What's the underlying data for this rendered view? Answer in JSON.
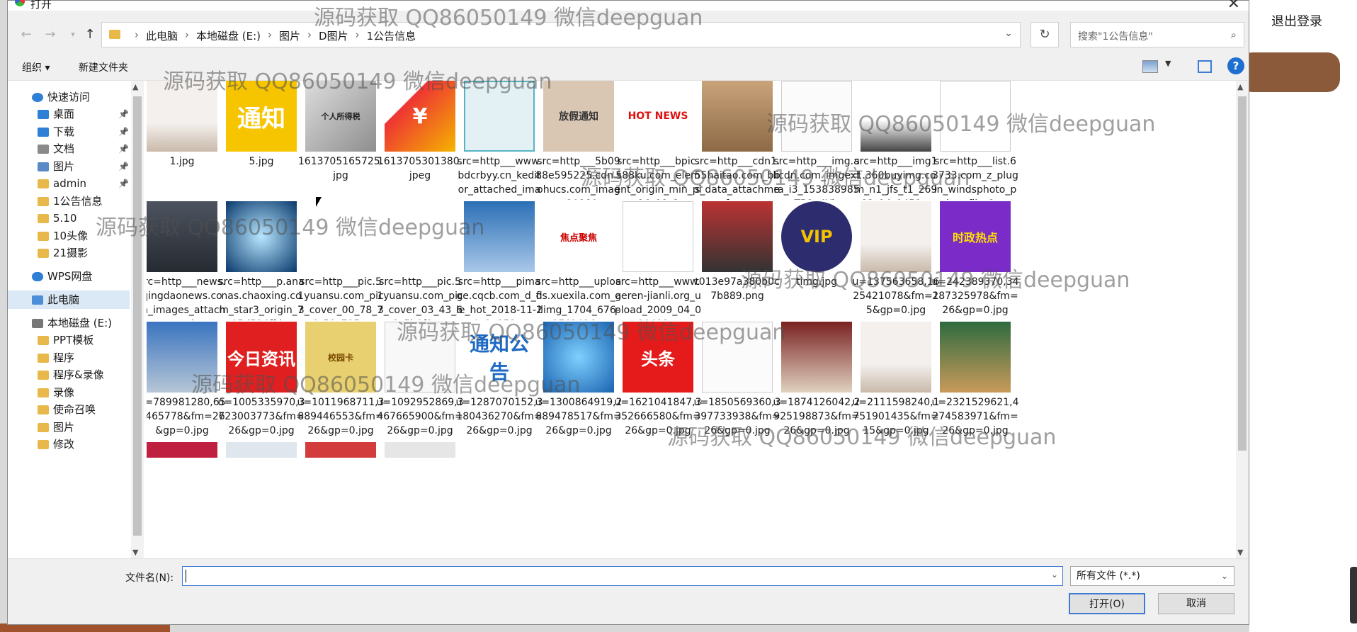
{
  "background_app": {
    "logout_label": "退出登录"
  },
  "dialog": {
    "title": "打开",
    "address": {
      "crumbs": [
        "此电脑",
        "本地磁盘 (E:)",
        "图片",
        "D图片",
        "1公告信息"
      ]
    },
    "search_placeholder": "搜索\"1公告信息\"",
    "toolbar": {
      "organize": "组织 ▾",
      "new_folder": "新建文件夹",
      "help": "?"
    },
    "nav": {
      "items": [
        {
          "label": "快速访问",
          "icon": "star-icon",
          "pinned": false
        },
        {
          "label": "桌面",
          "icon": "desktop-icon",
          "pinned": true
        },
        {
          "label": "下载",
          "icon": "download-icon",
          "pinned": true
        },
        {
          "label": "文档",
          "icon": "document-icon",
          "pinned": true
        },
        {
          "label": "图片",
          "icon": "pictures-icon",
          "pinned": true
        },
        {
          "label": "admin",
          "icon": "folder-icon",
          "pinned": true
        },
        {
          "label": "1公告信息",
          "icon": "folder-icon",
          "pinned": false
        },
        {
          "label": "5.10",
          "icon": "folder-icon",
          "pinned": false
        },
        {
          "label": "10头像",
          "icon": "folder-icon",
          "pinned": false
        },
        {
          "label": "21摄影",
          "icon": "folder-icon",
          "pinned": false
        },
        {
          "label": "WPS网盘",
          "icon": "cloud-icon",
          "pinned": false
        },
        {
          "label": "此电脑",
          "icon": "computer-icon",
          "pinned": false
        },
        {
          "label": "本地磁盘 (E:)",
          "icon": "drive-icon",
          "pinned": false
        },
        {
          "label": "PPT模板",
          "icon": "folder-icon",
          "pinned": false
        },
        {
          "label": "程序",
          "icon": "folder-icon",
          "pinned": false
        },
        {
          "label": "程序&录像",
          "icon": "folder-icon",
          "pinned": false
        },
        {
          "label": "录像",
          "icon": "folder-icon",
          "pinned": false
        },
        {
          "label": "使命召唤",
          "icon": "folder-icon",
          "pinned": false
        },
        {
          "label": "图片",
          "icon": "folder-icon",
          "pinned": false
        },
        {
          "label": "修改",
          "icon": "folder-icon",
          "pinned": false
        }
      ],
      "selected": "此电脑"
    },
    "files": [
      {
        "name": "1.jpg",
        "thumb": "board"
      },
      {
        "name": "5.jpg",
        "thumb": "tongzhi-yellow",
        "text": "通知"
      },
      {
        "name": "1613705165725.jpg",
        "thumb": "grey-photo",
        "text": "个人所得税"
      },
      {
        "name": "1613705301380.jpeg",
        "thumb": "red-chart",
        "text": "¥"
      },
      {
        "name": "src=http___www.bdcrbyy.cn_keditor_attached_image_...",
        "thumb": "flowchart"
      },
      {
        "name": "src=http___5b0988e595225.cdn.sohucs.com_images_20180...",
        "thumb": "sign",
        "text": "放假通知"
      },
      {
        "name": "src=http___bpic.588ku.com_element_origin_min_pic_16_11_3...",
        "thumb": "hotnews",
        "text": "HOT NEWS"
      },
      {
        "name": "src=http___cdn1.55haitao.com_bbs_data_attachment_forum...",
        "thumb": "boxes"
      },
      {
        "name": "src=http___img.alicdn.com_imgextra_i3_153838985_TB2x4Yl...",
        "thumb": "doc"
      },
      {
        "name": "src=http___img11.360buyimg.com_n1_jfs_t1_26983_14_1451...",
        "thumb": "wallboard"
      },
      {
        "name": "src=http___list.63733.com_z_plugin_windsphoto_photofile_2...",
        "thumb": "form"
      },
      {
        "name": "src=http___news.qingdaonews.com_images_attachement_jp...",
        "thumb": "office"
      },
      {
        "name": "src=http___p.ananas.chaoxing.com_star3_origin_705d524ffd...",
        "thumb": "blue-tech"
      },
      {
        "name": "src=http___pic.51yuansu.com_pic3_cover_00_78_76_58c715...",
        "thumb": "people-meeting"
      },
      {
        "name": "src=http___pic.51yuansu.com_pic3_cover_03_43_68_5b9f8c...",
        "thumb": "screen-people"
      },
      {
        "name": "src=http___pimage.cqcb.com_d_file_hot_2018-11-20_8e851...",
        "thumb": "storefront"
      },
      {
        "name": "src=http___uploads.xuexila.com_allimg_1704_676-1F41416...",
        "thumb": "focus",
        "text": "焦点聚焦"
      },
      {
        "name": "src=http___www.geren-jianli.org_upload_2009_04_090412...",
        "thumb": "paper"
      },
      {
        "name": "t013e97a380b0c7b889.png",
        "thumb": "lecture"
      },
      {
        "name": "timg.jpg",
        "thumb": "vip",
        "text": "VIP"
      },
      {
        "name": "u=137563658,1625421078&fm=15&gp=0.jpg",
        "thumb": "board"
      },
      {
        "name": "u=242389370,34287325978&fm=26&gp=0.jpg",
        "thumb": "politics",
        "text": "时政热点"
      },
      {
        "name": "u=789981280,651465778&fm=26&gp=0.jpg",
        "thumb": "building"
      },
      {
        "name": "u=1005335970,3723003773&fm=26&gp=0.jpg",
        "thumb": "jinri",
        "text": "今日资讯"
      },
      {
        "name": "u=1011968711,3889446553&fm=26&gp=0.jpg",
        "thumb": "card",
        "text": "校园卡"
      },
      {
        "name": "u=1092952869,3467665900&fm=26&gp=0.jpg",
        "thumb": "whiteboard"
      },
      {
        "name": "u=1287070152,3180436270&fm=26&gp=0.jpg",
        "thumb": "tongzhi-blue",
        "text": "通知公告"
      },
      {
        "name": "u=1300864919,2889478517&fm=26&gp=0.jpg",
        "thumb": "globe"
      },
      {
        "name": "u=1621041847,3352666580&fm=26&gp=0.jpg",
        "thumb": "toutiao",
        "text": "头条"
      },
      {
        "name": "u=1850569360,3397733938&fm=26&gp=0.jpg",
        "thumb": "doc"
      },
      {
        "name": "u=1874126042,2925198873&fm=26&gp=0.jpg",
        "thumb": "conference"
      },
      {
        "name": "u=2111598240,1751901435&fm=15&gp=0.jpg",
        "thumb": "board"
      },
      {
        "name": "u=2321529621,4274583971&fm=26&gp=0.jpg",
        "thumb": "classroom"
      }
    ],
    "filename_label": "文件名(N):",
    "filename_value": "",
    "filetype": "所有文件 (*.*)",
    "open_button": "打开(O)",
    "cancel_button": "取消"
  },
  "watermark": "源码获取 QQ86050149 微信deepguan"
}
